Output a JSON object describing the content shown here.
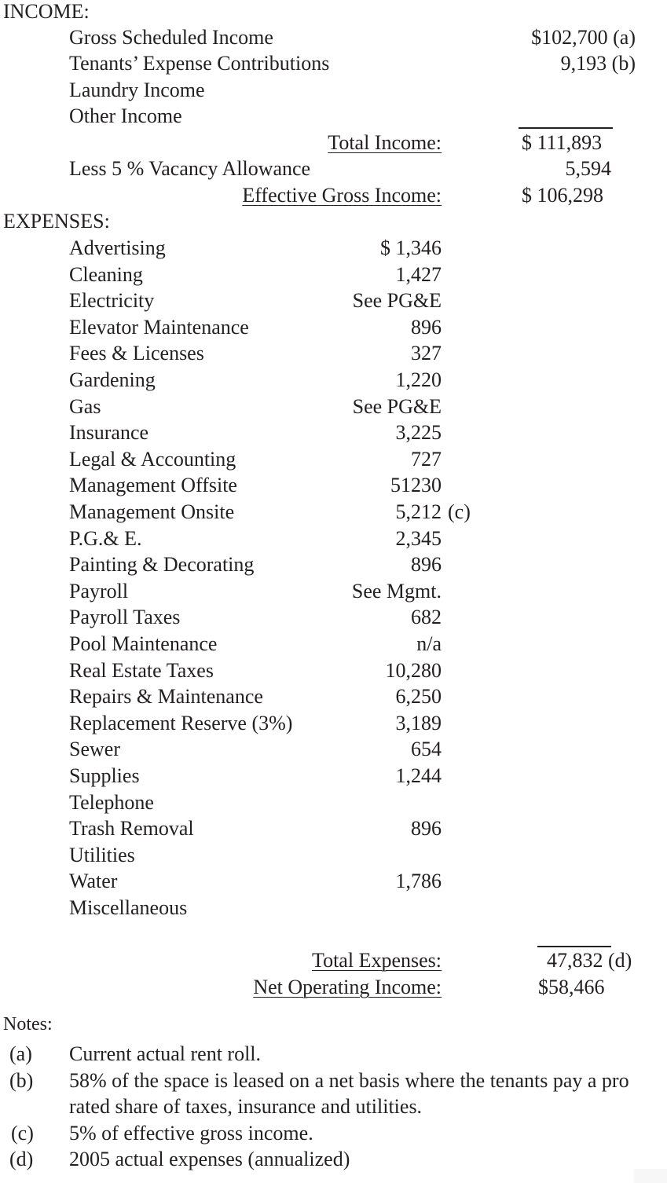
{
  "income": {
    "heading": "INCOME:",
    "items": [
      {
        "label": "Gross Scheduled Income",
        "value": "$102,700 (a)"
      },
      {
        "label": "Tenants’ Expense Contributions",
        "value": "9,193 (b)"
      },
      {
        "label": "Laundry Income",
        "value": ""
      },
      {
        "label": "Other Income",
        "value": ""
      }
    ],
    "total_label": "Total Income:",
    "total_value": "$ 111,893",
    "vacancy_label": "Less 5 % Vacancy Allowance",
    "vacancy_value": "5,594",
    "egi_label": "Effective Gross Income:",
    "egi_value": "$ 106,298"
  },
  "expenses": {
    "heading": "EXPENSES:",
    "items": [
      {
        "label": "Advertising",
        "value": "$ 1,346"
      },
      {
        "label": "Cleaning",
        "value": "1,427"
      },
      {
        "label": "Electricity",
        "value": "See PG&E"
      },
      {
        "label": "Elevator Maintenance",
        "value": "896"
      },
      {
        "label": "Fees & Licenses",
        "value": "327"
      },
      {
        "label": "Gardening",
        "value": "1,220"
      },
      {
        "label": "Gas",
        "value": "See PG&E"
      },
      {
        "label": "Insurance",
        "value": "3,225"
      },
      {
        "label": "Legal & Accounting",
        "value": "727"
      },
      {
        "label": "Management Offsite",
        "value": "51230"
      },
      {
        "label": "Management Onsite",
        "value": "5,212",
        "note": "(c)"
      },
      {
        "label": "P.G.& E.",
        "value": "2,345"
      },
      {
        "label": "Painting & Decorating",
        "value": "896"
      },
      {
        "label": "Payroll",
        "value": "See Mgmt."
      },
      {
        "label": "Payroll Taxes",
        "value": "682"
      },
      {
        "label": "Pool Maintenance",
        "value": "n/a"
      },
      {
        "label": "Real Estate Taxes",
        "value": "10,280"
      },
      {
        "label": "Repairs & Maintenance",
        "value": "6,250"
      },
      {
        "label": "Replacement Reserve (3%)",
        "value": "3,189"
      },
      {
        "label": "Sewer",
        "value": "654"
      },
      {
        "label": "Supplies",
        "value": "1,244"
      },
      {
        "label": "Telephone",
        "value": ""
      },
      {
        "label": "Trash Removal",
        "value": "896"
      },
      {
        "label": "Utilities",
        "value": ""
      },
      {
        "label": "Water",
        "value": "1,786"
      },
      {
        "label": "Miscellaneous",
        "value": ""
      }
    ],
    "total_label": "Total Expenses:",
    "total_value": "47,832 (d)",
    "noi_label": "Net Operating Income:",
    "noi_value": "$58,466"
  },
  "notes": {
    "heading": "Notes:",
    "items": [
      {
        "marker": "(a)",
        "lines": [
          "Current actual rent roll."
        ]
      },
      {
        "marker": "(b)",
        "lines": [
          "58% of the space is leased on a net basis where the tenants pay a pro",
          "rated share of taxes, insurance and utilities."
        ]
      },
      {
        "marker": "(c)",
        "lines": [
          "5% of effective gross income."
        ]
      },
      {
        "marker": "(d)",
        "lines": [
          "2005 actual expenses (annualized)"
        ]
      }
    ]
  }
}
